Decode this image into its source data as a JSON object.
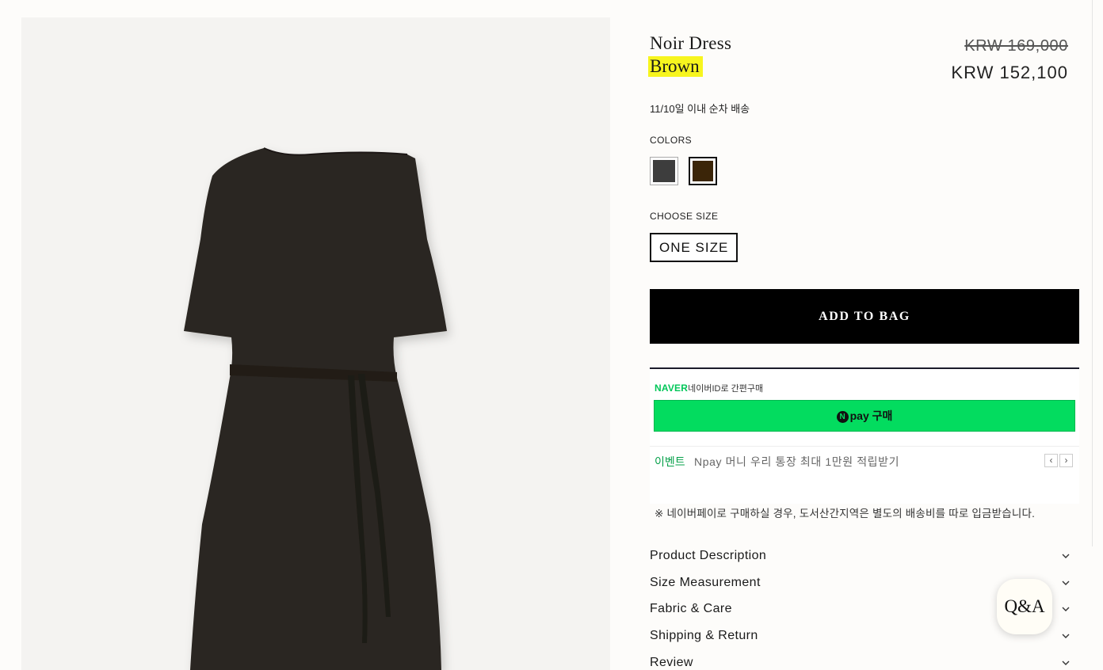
{
  "product": {
    "name": "Noir Dress",
    "color_name": "Brown",
    "price_original": "KRW 169,000",
    "price_sale": "KRW 152,100",
    "shipping_note": "11/10일 이내 순차 배송"
  },
  "colors": {
    "label": "COLORS",
    "swatches": [
      {
        "name": "charcoal",
        "hex": "#3d3d3d",
        "selected": false
      },
      {
        "name": "brown",
        "hex": "#3b2508",
        "selected": true
      }
    ]
  },
  "size": {
    "label": "CHOOSE SIZE",
    "option": "ONE SIZE"
  },
  "add_to_bag_label": "ADD TO BAG",
  "npay": {
    "brand": "NAVER",
    "brand_sub": "네이버ID로 간편구매",
    "button_label": "pay 구매",
    "event_tag": "이벤트",
    "event_text": "Npay 머니 우리 통장 최대 1만원 적립받기",
    "prev_label": "‹",
    "next_label": "›"
  },
  "notice": "※ 네이버페이로 구매하실 경우, 도서산간지역은 별도의 배송비를 따로 입금받습니다.",
  "accordion": [
    "Product Description",
    "Size Measurement",
    "Fabric & Care",
    "Shipping & Return",
    "Review"
  ],
  "qa_label": "Q&A",
  "colors_theme": {
    "accent_black": "#000000",
    "npay_green": "#03dc5f",
    "highlight_yellow": "#f7f51e"
  }
}
